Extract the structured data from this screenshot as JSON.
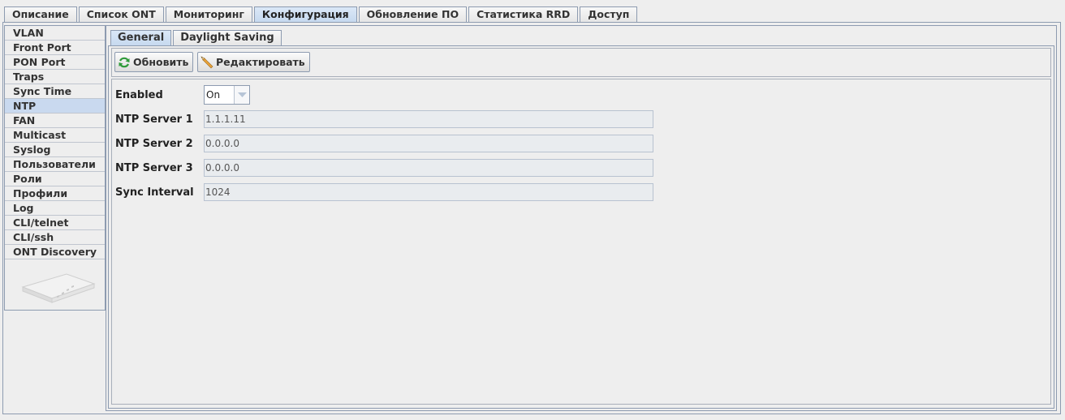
{
  "top_tabs": [
    "Описание",
    "Список ONT",
    "Мониторинг",
    "Конфигурация",
    "Обновление ПО",
    "Статистика RRD",
    "Доступ"
  ],
  "top_tabs_active": "Конфигурация",
  "sidebar": {
    "items": [
      "VLAN",
      "Front Port",
      "PON Port",
      "Traps",
      "Sync Time",
      "NTP",
      "FAN",
      "Multicast",
      "Syslog",
      "Пользователи",
      "Роли",
      "Профили",
      "Log",
      "CLI/telnet",
      "CLI/ssh",
      "ONT Discovery"
    ],
    "active": "NTP",
    "device_image": "olt-device-image"
  },
  "sub_tabs": [
    "General",
    "Daylight Saving"
  ],
  "sub_tabs_active": "General",
  "toolbar": {
    "refresh_label": "Обновить",
    "refresh_icon": "refresh-icon",
    "edit_label": "Редактировать",
    "edit_icon": "pencil-icon"
  },
  "form": {
    "enabled": {
      "label": "Enabled",
      "value": "On"
    },
    "ntp_server_1": {
      "label": "NTP Server 1",
      "value": "1.1.1.11"
    },
    "ntp_server_2": {
      "label": "NTP Server 2",
      "value": "0.0.0.0"
    },
    "ntp_server_3": {
      "label": "NTP Server 3",
      "value": "0.0.0.0"
    },
    "sync_interval": {
      "label": "Sync Interval",
      "value": "1024"
    }
  },
  "colors": {
    "active_tab": "#c6d9ef",
    "border": "#8d9bb0",
    "background": "#eeeeee"
  }
}
